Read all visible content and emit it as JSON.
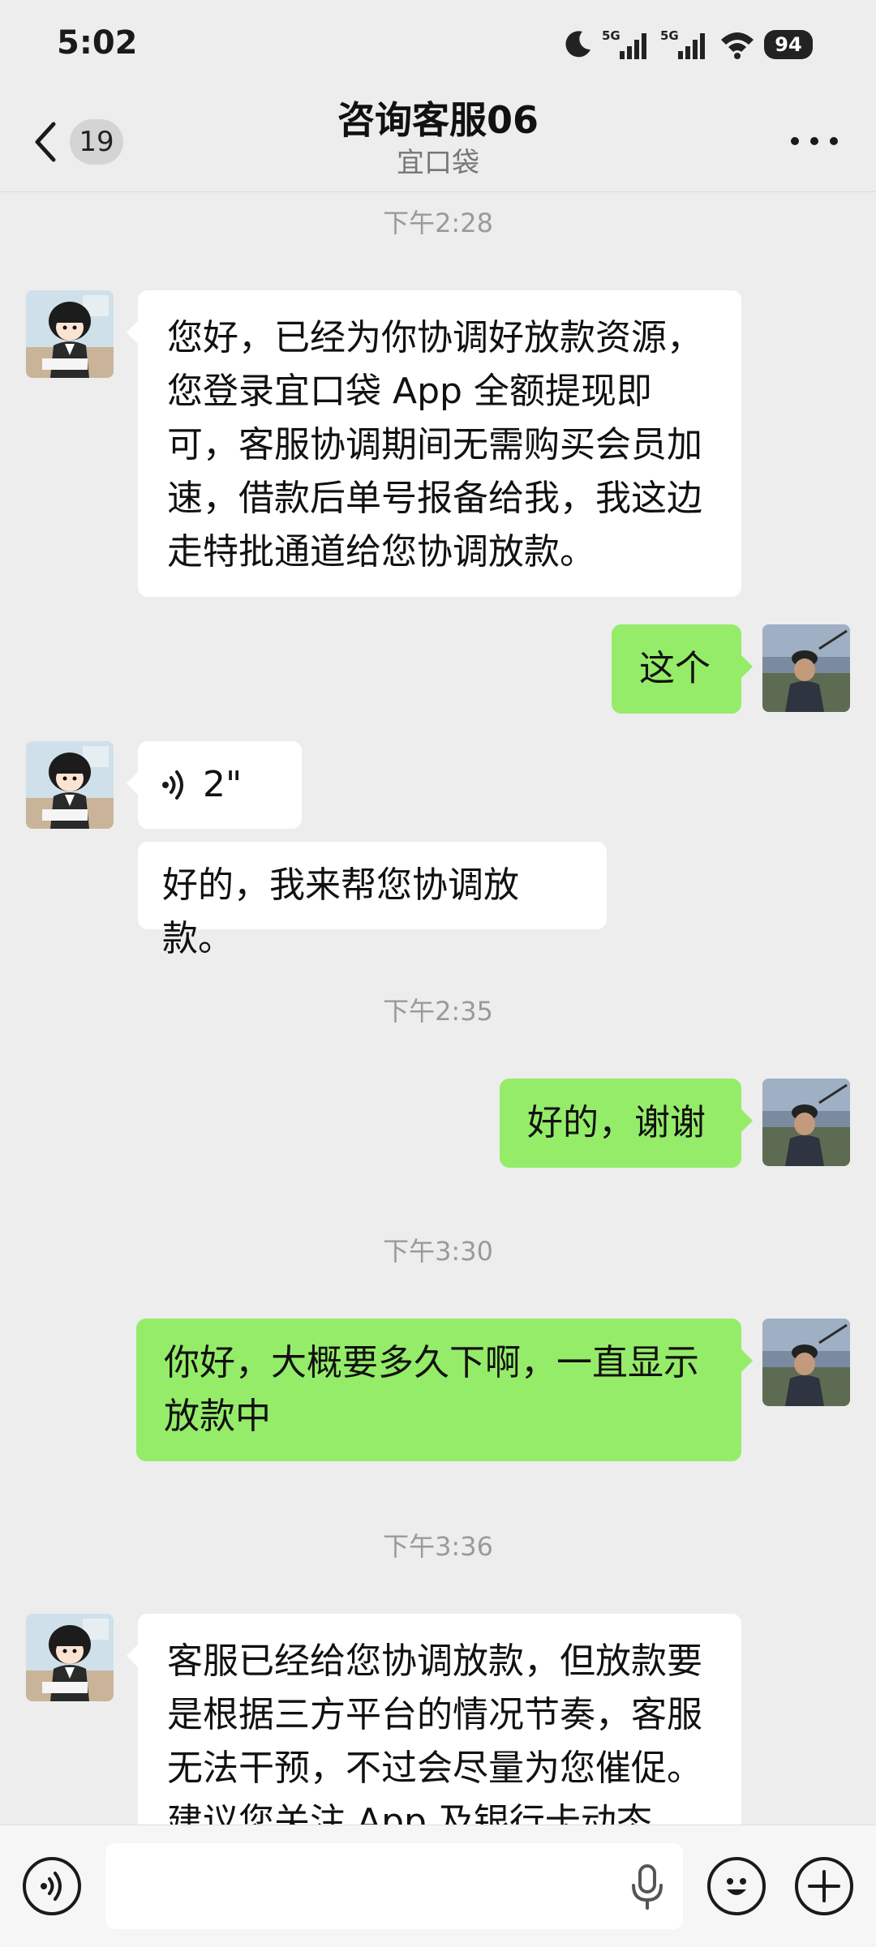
{
  "status_bar": {
    "time": "5:02",
    "battery": "94",
    "network1": "5G",
    "network2": "5G"
  },
  "header": {
    "back_badge": "19",
    "title": "咨询客服06",
    "subtitle": "宜口袋"
  },
  "messages": {
    "ts1": "下午2:28",
    "m1": "您好，已经为你协调好放款资源，您登录宜口袋 App 全额提现即可，客服协调期间无需购买会员加速，借款后单号报备给我，我这边走特批通道给您协调放款。",
    "m2": "这个",
    "m3_voice": "2\"",
    "m4": "好的，我来帮您协调放款。",
    "ts2": "下午2:35",
    "m5": "好的，谢谢",
    "ts3": "下午3:30",
    "m6": "你好，大概要多久下啊，一直显示放款中",
    "ts4": "下午3:36",
    "m7": "客服已经给您协调放款，但放款要是根据三方平台的情况节奏，客服无法干预，不过会尽量为您催促。建议您关注 App 及银行卡动态"
  },
  "input": {
    "value": ""
  },
  "icons": {
    "voice_toggle": "voice-icon",
    "mic": "microphone-icon",
    "emoji": "emoji-icon",
    "plus": "plus-icon"
  }
}
